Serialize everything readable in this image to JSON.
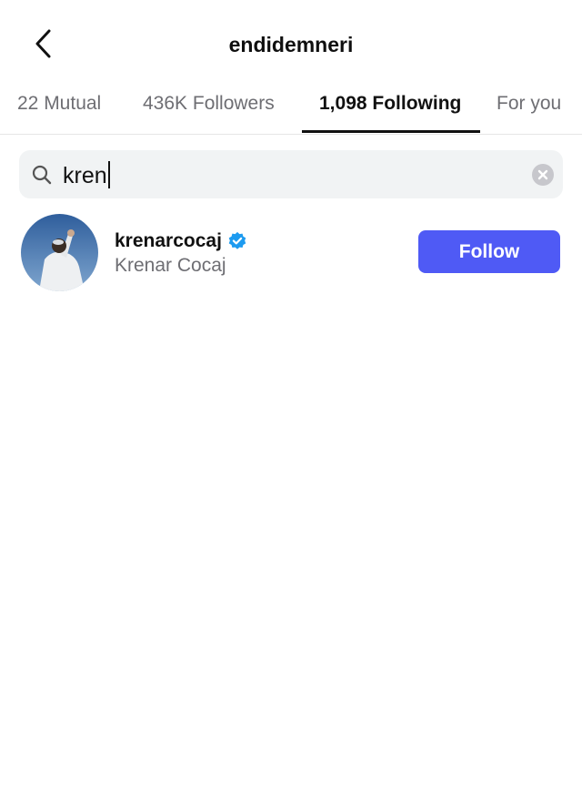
{
  "header": {
    "title": "endidemneri",
    "back_icon": "chevron-left-icon"
  },
  "tabs": [
    {
      "label": "22 Mutual",
      "active": false
    },
    {
      "label": "436K Followers",
      "active": false
    },
    {
      "label": "1,098 Following",
      "active": true
    },
    {
      "label": "For you",
      "active": false
    }
  ],
  "search": {
    "value": "kren",
    "icon": "search-icon",
    "clear_icon": "clear-circle-icon"
  },
  "results": [
    {
      "username": "krenarcocaj",
      "verified": true,
      "full_name": "Krenar Cocaj",
      "action_label": "Follow"
    }
  ],
  "colors": {
    "follow_button": "#4f5af5",
    "verified_badge": "#1d9bf0",
    "secondary_text": "#6e6e73",
    "search_background": "#f1f3f4"
  }
}
